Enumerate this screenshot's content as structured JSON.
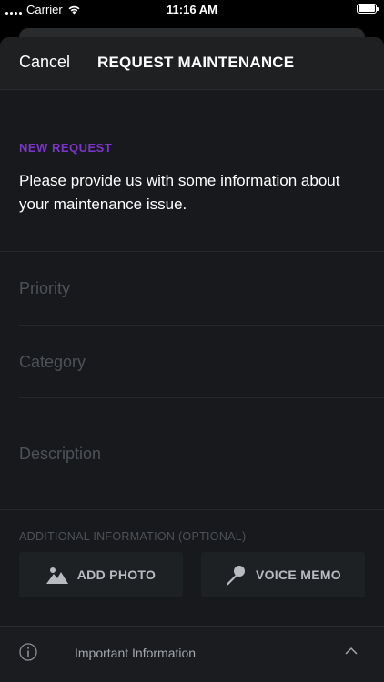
{
  "status_bar": {
    "carrier": "Carrier",
    "time": "11:16 AM"
  },
  "nav": {
    "cancel_label": "Cancel",
    "title": "REQUEST MAINTENANCE"
  },
  "form": {
    "section_label": "NEW REQUEST",
    "intro": "Please provide us with some information about your maintenance issue.",
    "fields": {
      "priority_placeholder": "Priority",
      "category_placeholder": "Category",
      "description_placeholder": "Description"
    },
    "optional_label": "ADDITIONAL INFORMATION (OPTIONAL)",
    "add_photo_label": "ADD PHOTO",
    "voice_memo_label": "VOICE MEMO"
  },
  "footer": {
    "important_info_label": "Important Information"
  },
  "colors": {
    "accent": "#7b36c9",
    "background": "#17191c",
    "placeholder": "#4d5258"
  },
  "icons": [
    "wifi-icon",
    "battery-icon",
    "photo-icon",
    "microphone-icon",
    "info-icon",
    "chevron-up-icon"
  ]
}
